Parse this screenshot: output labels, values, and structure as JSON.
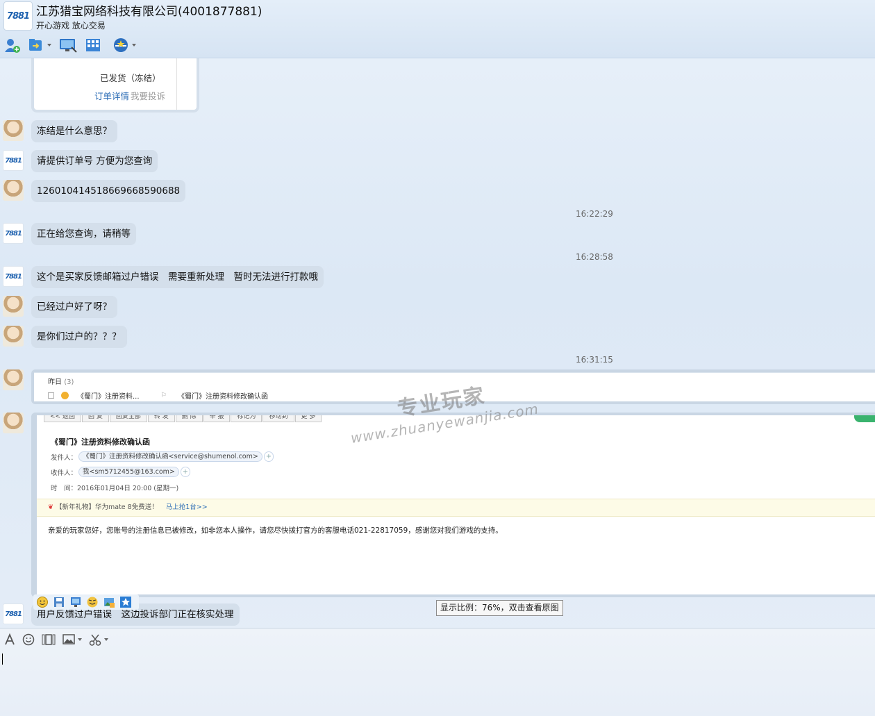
{
  "window": {
    "title": "江苏猎宝网络科技有限公司(4001877881)",
    "subtitle": "开心游戏 放心交易",
    "logo_text": "7881"
  },
  "toolbar": {
    "items": [
      "add-contact-icon",
      "send-file-icon",
      "remote-desktop-icon",
      "app-grid-icon",
      "service-badge-icon"
    ]
  },
  "order_card": {
    "status": "已发货（冻结）",
    "detail_link": "订单详情",
    "complain_link": "我要投诉"
  },
  "messages": [
    {
      "from": "user",
      "text": "冻结是什么意思？"
    },
    {
      "from": "service",
      "text": "请提供订单号 方便为您查询"
    },
    {
      "from": "user",
      "text": "126010414518669668590688"
    },
    {
      "time": "16:22:29"
    },
    {
      "from": "service",
      "text": "正在给您查询，请稍等"
    },
    {
      "time": "16:28:58"
    },
    {
      "from": "service",
      "text": "这个是买家反馈邮箱过户错误　需要重新处理　暂时无法进行打款哦"
    },
    {
      "from": "user",
      "text": "已经过户好了呀？"
    },
    {
      "from": "user",
      "text": "是你们过户的？？？"
    },
    {
      "time": "16:31:15"
    },
    {
      "from": "service",
      "text": "用户反馈过户错误　这边投诉部门正在核实处理"
    }
  ],
  "mail_strip": {
    "date_label": "昨日",
    "count": "(3)",
    "sender": "《蜀门》注册资料...",
    "subject": "《蜀门》注册资料修改确认函"
  },
  "mail_view": {
    "buttons": [
      "<< 返回",
      "回 复",
      "回复全部",
      "转 发",
      "删 除",
      "举 报",
      "标记为",
      "移动到",
      "更 多"
    ],
    "subject": "《蜀门》注册资料修改确认函",
    "from_label": "发件人：",
    "from_value": "《蜀门》注册资料修改确认函<service@shumenol.com>",
    "to_label": "收件人：",
    "to_value": "我<sm5712455@163.com>",
    "time_label": "时　间：",
    "time_value": "2016年01月04日 20:00 (星期一)",
    "promo_text": "【新年礼物】华为mate 8免费送！",
    "promo_link": "马上抢1台>>",
    "body": "亲爱的玩家您好，您账号的注册信息已被修改，如非您本人操作，请您尽快拨打官方的客服电话021-22817059，感谢您对我们游戏的支持。"
  },
  "zoom_tip": "显示比例：76%，双击查看原图",
  "watermark": {
    "cn": "专业玩家",
    "en": "www.zhuanyewanjia.com"
  },
  "input_toolbar": [
    "font-icon",
    "emoji-icon",
    "video-icon",
    "image-icon",
    "screenshot-icon"
  ],
  "colors": {
    "bubble": "#d4dfeb",
    "link": "#2a6bb5",
    "brand_blue": "#1b5fae",
    "brand_red": "#e2411c"
  }
}
